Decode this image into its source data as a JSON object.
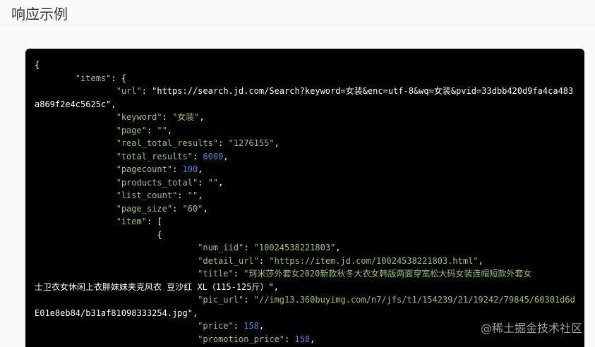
{
  "header": {
    "title": "响应示例"
  },
  "code": {
    "lines": [
      [
        "{"
      ],
      [
        "        ",
        "\"items\"",
        ": {"
      ],
      [
        "                ",
        "\"url\"",
        ": ",
        "\"https://search.jd.com/Search?keyword=女装&enc=utf-8&wq=女装&pvid=33dbb420d9fa4ca483"
      ],
      [
        "",
        "a869f2e4c5625c\"",
        ","
      ],
      [
        "                ",
        "\"keyword\"",
        ": ",
        "\"女装\"",
        ","
      ],
      [
        "                ",
        "\"page\"",
        ": ",
        "\"\"",
        ","
      ],
      [
        "                ",
        "\"real_total_results\"",
        ": ",
        "\"1276155\"",
        ","
      ],
      [
        "                ",
        "\"total_results\"",
        ": ",
        "6000",
        ","
      ],
      [
        "                ",
        "\"pagecount\"",
        ": ",
        "100",
        ","
      ],
      [
        "                ",
        "\"products_total\"",
        ": ",
        "\"\"",
        ","
      ],
      [
        "                ",
        "\"list_count\"",
        ": ",
        "\"\"",
        ","
      ],
      [
        "                ",
        "\"page_size\"",
        ": ",
        "\"60\"",
        ","
      ],
      [
        "                ",
        "\"item\"",
        ": ["
      ],
      [
        "                        {"
      ],
      [
        "                                ",
        "\"num_iid\"",
        ": ",
        "\"10024538221803\"",
        ","
      ],
      [
        "                                ",
        "\"detail_url\"",
        ": ",
        "\"https://item.jd.com/10024538221803.html\"",
        ","
      ],
      [
        "                                ",
        "\"title\"",
        ": ",
        "\"珂米莎外套女2020新款秋冬大衣女韩版两面穿宽松大码女装连帽短款外套女"
      ],
      [
        "",
        "士卫衣女休闲上衣胖妹妹夹克风衣 豆沙红 XL（115-125斤）\"",
        ","
      ],
      [
        "                                ",
        "\"pic_url\"",
        ": ",
        "\"//img13.360buyimg.com/n7/jfs/t1/154239/21/19242/79845/60301d6d"
      ],
      [
        "",
        "E01e8eb84/b31af81098333254.jpg\"",
        ","
      ],
      [
        "                                ",
        "\"price\"",
        ": ",
        "158",
        ","
      ],
      [
        "                                ",
        "\"promotion_price\"",
        ": ",
        "158",
        ","
      ]
    ]
  },
  "watermark": {
    "text": "@稀土掘金技术社区"
  }
}
